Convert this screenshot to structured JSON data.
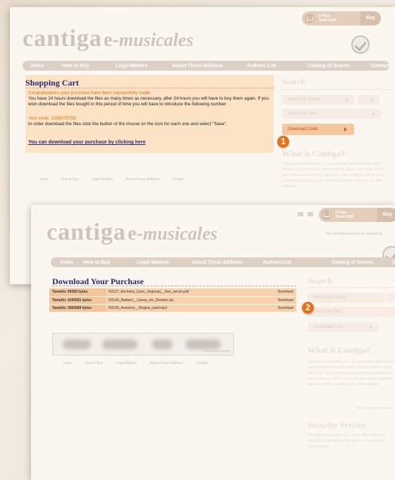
{
  "site": {
    "logo_main": "cantiga",
    "logo_e": "e-",
    "logo_sub": "musicales",
    "nav": [
      "Index",
      "How to Buy",
      "Legal Matters",
      "About These Editions",
      "Authors List",
      "Catalog of Scores",
      "Contact"
    ],
    "cart": {
      "files_label": "0 Files",
      "total_label": "Total 0.00€",
      "buy_label": "Buy"
    },
    "footer_nav": [
      "Index",
      "How to Buy",
      "Legal Matters",
      "About These Editions",
      "Contact"
    ],
    "secure_note": "The purchase process is secured by"
  },
  "sidebar": {
    "search_heading": "Search",
    "search_by_author": "Search by Author",
    "search_by_title": "Search by Title",
    "download_code": "Download Code",
    "what_heading": "What is Cantiga?",
    "what_text": "Cantiga e-musicales S.L. is a company that aims to make known musical scores, mainly within scope the coral, vocal and instrumental music, using our own Editions online in our domain www.cantiga.es. Several of these Editions are first editions",
    "more_link": "More about the editions",
    "security_heading": "Security Service",
    "security_text": "Cantiga e-musicales S.L. uses safe tools and security certificates in its service of electronic transactions."
  },
  "shopping_cart": {
    "title": "Shopping Cart",
    "msg_orange": "Congratulations your purchase have been successfully made.",
    "msg_dark": "You have 24 hours download the files as many times as necessary, after 24 hours you will have to buy them again. If you wish download the files bought in this period of time you will have to introduce the following number:",
    "code_line": "Your code: 1298375782",
    "instructions": "In order download the files click the button of the mouse on the icon for each one and select \"Save\".",
    "download_link": "You can download your purchase by clicking here"
  },
  "download_purchase": {
    "title": "Download Your Purchase",
    "files": [
      {
        "size": "Tamaño: 69383 bytes",
        "name": "R2117_Anchieta_(canc_Segovia)__Ave_verum.pdf",
        "action": "Download"
      },
      {
        "size": "Tamaño: 4195051 bytes",
        "name": "R2140_Barbieri__Libera_me_Domine.zip",
        "action": "Download"
      },
      {
        "size": "Tamaño: 3569360 bytes",
        "name": "R2145_Anonimo__Regina_caeli.mp3",
        "action": "Download"
      }
    ],
    "ad_label": "Anuncios Google"
  },
  "steps": {
    "step1": "1",
    "step2": "2"
  },
  "colors": {
    "accent_orange": "#e46c0a",
    "title_navy": "#2c2a6e",
    "highlight_peach": "#fde3c6"
  }
}
